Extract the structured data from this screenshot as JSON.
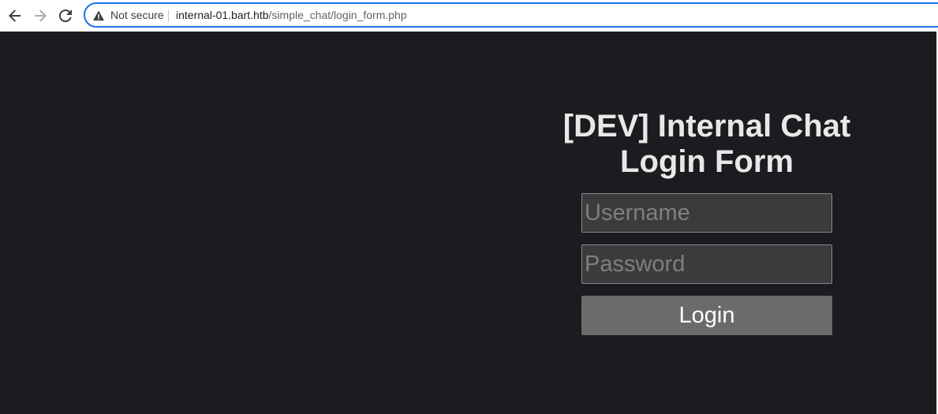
{
  "browser": {
    "security_label": "Not secure",
    "url_host": "internal-01.bart.htb",
    "url_path": "/simple_chat/login_form.php",
    "icons": {
      "back": "arrow-left-icon",
      "forward": "arrow-right-icon",
      "reload": "reload-icon",
      "security": "warning-triangle-icon"
    }
  },
  "login": {
    "title_line1": "[DEV] Internal Chat",
    "title_line2": "Login Form",
    "username_placeholder": "Username",
    "password_placeholder": "Password",
    "submit_label": "Login"
  },
  "colors": {
    "page_background": "#1b1c1f",
    "field_background": "#3b3b3d",
    "button_background": "#6b6b6b",
    "omnibox_focus": "#1a73e8"
  }
}
